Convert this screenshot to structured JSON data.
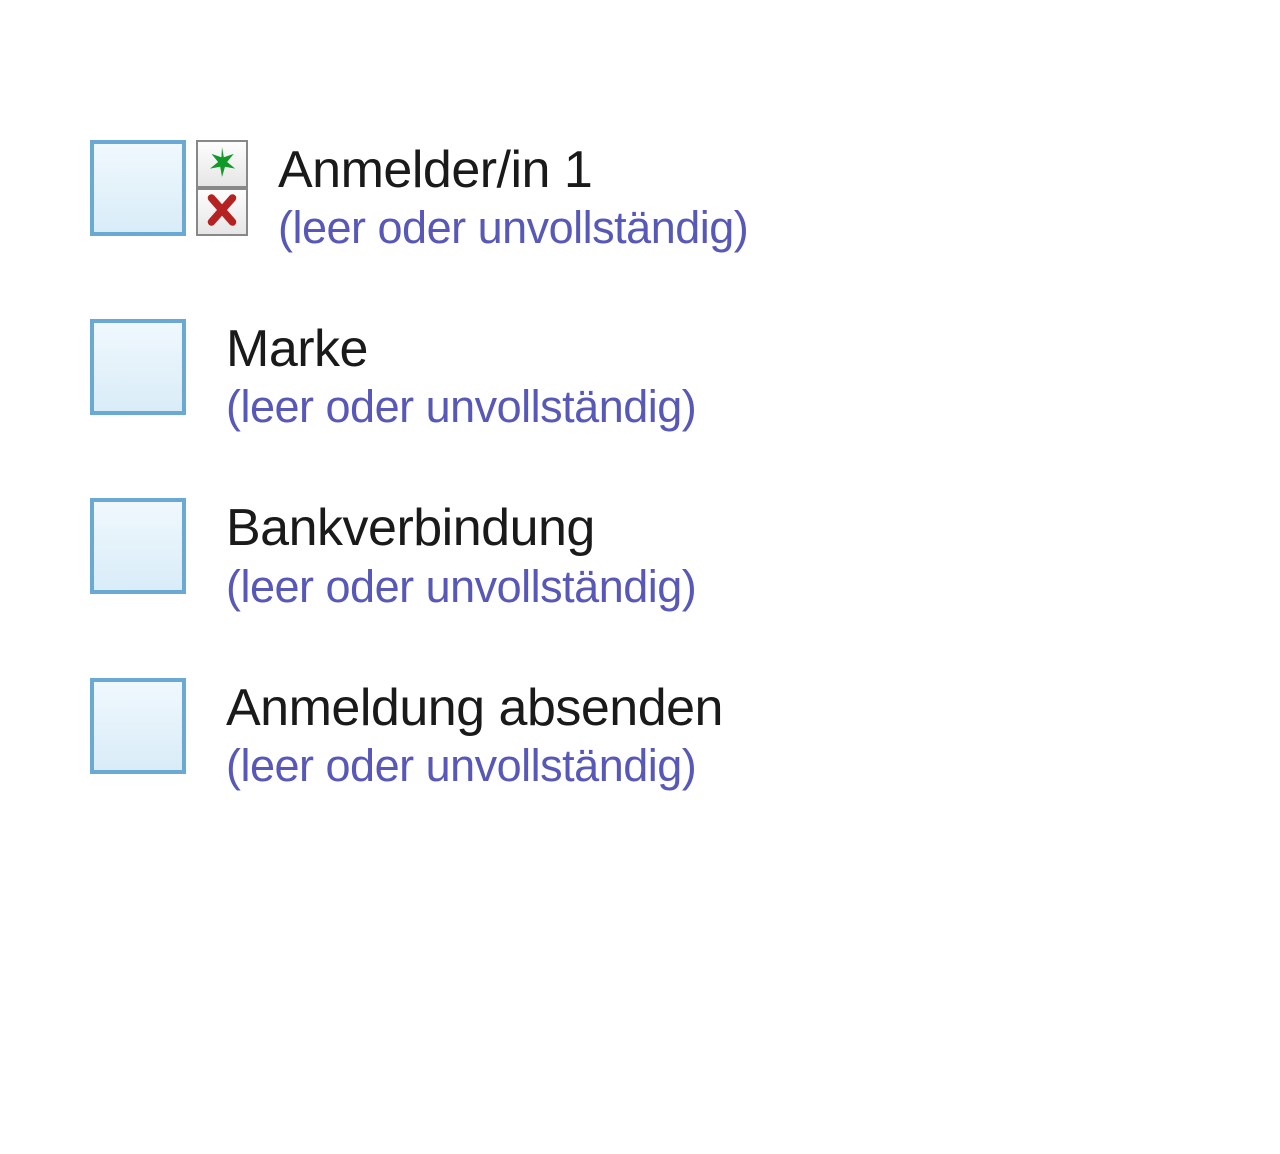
{
  "items": [
    {
      "title": "Anmelder/in 1",
      "status": "(leer oder unvollständig)",
      "hasActions": true
    },
    {
      "title": "Marke",
      "status": "(leer oder unvollständig)",
      "hasActions": false
    },
    {
      "title": "Bankverbindung",
      "status": "(leer oder unvollständig)",
      "hasActions": false
    },
    {
      "title": "Anmeldung absenden",
      "status": "(leer oder unvollständig)",
      "hasActions": false
    }
  ]
}
